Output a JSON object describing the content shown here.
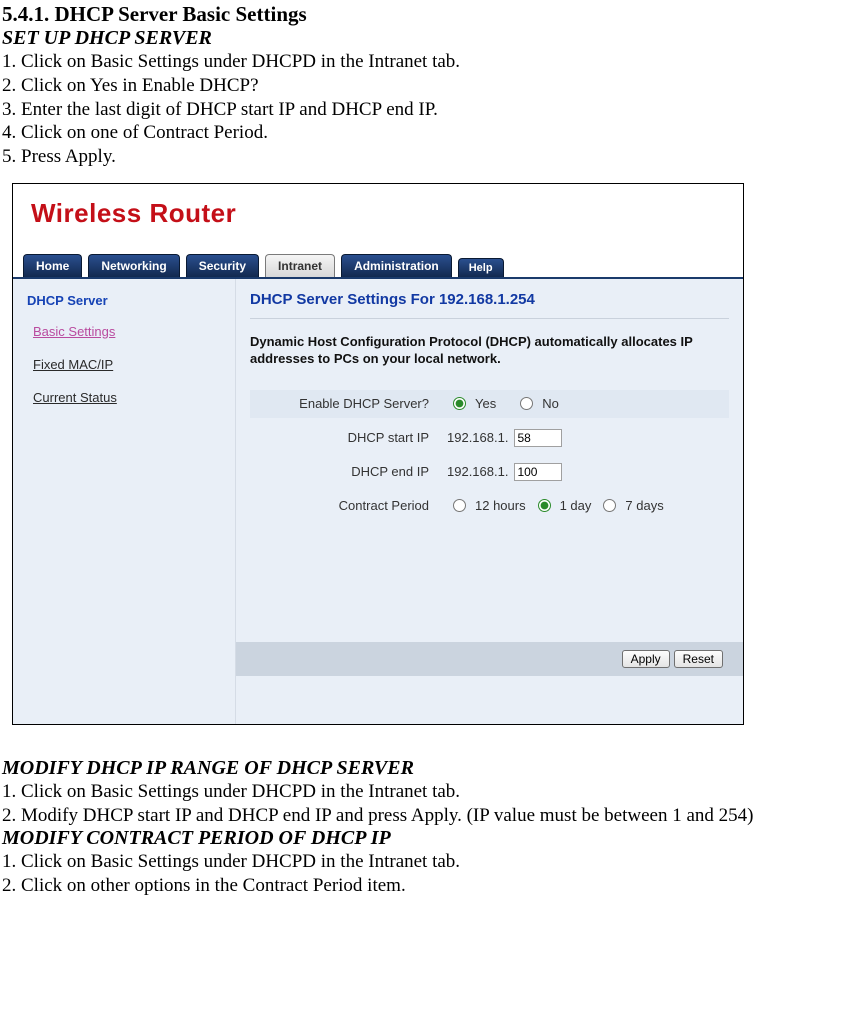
{
  "doc": {
    "heading": "5.4.1. DHCP Server Basic Settings",
    "sub1": "SET UP DHCP SERVER",
    "steps1": [
      "1. Click on Basic Settings under DHCPD in the Intranet tab.",
      "2. Click on Yes in Enable DHCP?",
      "3. Enter the last digit of DHCP start IP and DHCP end IP.",
      "4. Click on one of Contract Period.",
      "5. Press Apply."
    ],
    "sub2": "MODIFY DHCP IP RANGE OF DHCP SERVER",
    "steps2": [
      "1. Click on Basic Settings under DHCPD in the Intranet tab.",
      "2. Modify DHCP start IP and DHCP end IP and press Apply. (IP value must be between 1 and 254)"
    ],
    "sub3": "MODIFY CONTRACT PERIOD OF DHCP IP",
    "steps3": [
      "1. Click on Basic Settings under DHCPD in the Intranet tab.",
      "2. Click on other options in the Contract Period item."
    ]
  },
  "app": {
    "logo": "Wireless Router",
    "tabs": {
      "home": "Home",
      "networking": "Networking",
      "security": "Security",
      "intranet": "Intranet",
      "administration": "Administration",
      "help": "Help"
    },
    "sidebar": {
      "title": "DHCP Server",
      "items": [
        "Basic Settings",
        "Fixed MAC/IP",
        "Current Status"
      ]
    },
    "content": {
      "title": "DHCP Server Settings For 192.168.1.254",
      "description": "Dynamic Host Configuration Protocol (DHCP) automatically allocates IP addresses to PCs on your local network.",
      "rows": {
        "enable_label": "Enable DHCP Server?",
        "enable_yes": "Yes",
        "enable_no": "No",
        "enable_value": "yes",
        "start_label": "DHCP start IP",
        "start_prefix": "192.168.1.",
        "start_value": "58",
        "end_label": "DHCP end IP",
        "end_prefix": "192.168.1.",
        "end_value": "100",
        "contract_label": "Contract Period",
        "contract_opts": [
          "12 hours",
          "1 day",
          "7 days"
        ],
        "contract_value": "1 day"
      },
      "buttons": {
        "apply": "Apply",
        "reset": "Reset"
      }
    }
  }
}
